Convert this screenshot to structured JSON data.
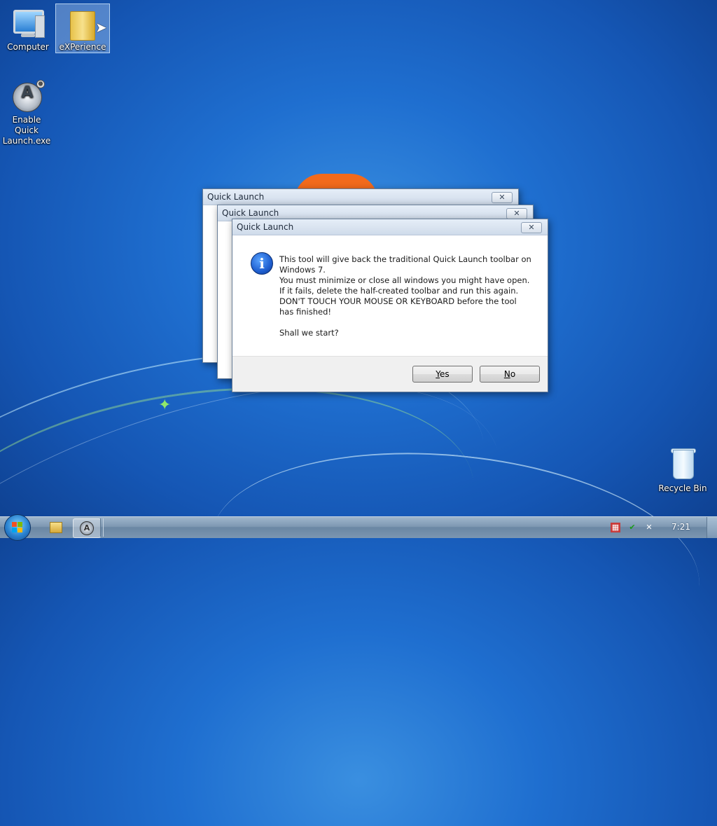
{
  "desktop": {
    "icons": [
      {
        "label": "Computer",
        "icon": "computer-icon"
      },
      {
        "label": "eXPerience",
        "icon": "folder-icon"
      },
      {
        "label": "Enable Quick Launch.exe",
        "icon": "quick-launch-app-icon"
      },
      {
        "label": "Recycle Bin",
        "icon": "recycle-bin-icon"
      }
    ]
  },
  "dialogs": {
    "back1_title": "Quick Launch",
    "back2_title": "Quick Launch",
    "front": {
      "title": "Quick Launch",
      "close_glyph": "✕",
      "info_glyph": "i",
      "message": {
        "line1": "This tool will give back the traditional Quick Launch toolbar on Windows 7.",
        "line2": "You must minimize or close all windows you might have open.",
        "line3": "If it fails, delete the half-created toolbar and run this again.",
        "line4": "DON'T TOUCH YOUR MOUSE OR KEYBOARD before the tool has finished!",
        "question": "Shall we start?"
      },
      "yes_label_u": "Y",
      "yes_label_rest": "es",
      "no_label_u": "N",
      "no_label_rest": "o"
    }
  },
  "taskbar": {
    "clock": "7:21",
    "tray_icons": [
      "network-icon",
      "action-center-icon",
      "volume-muted-icon"
    ]
  },
  "colors": {
    "accent": "#1f6fd0",
    "taskbar": "#7e98b2"
  }
}
